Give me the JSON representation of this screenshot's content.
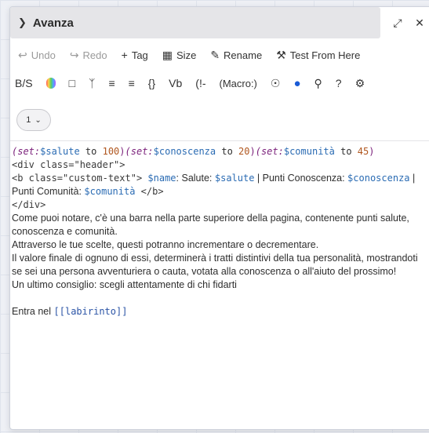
{
  "dialog": {
    "title": "Avanza",
    "collapse_icon": "chevron-down-icon",
    "maximize_icon": "expand-icon",
    "close_icon": "close-icon"
  },
  "toolbar1": {
    "undo": "Undo",
    "redo": "Redo",
    "tag": "Tag",
    "size": "Size",
    "rename": "Rename",
    "test": "Test From Here"
  },
  "toolbar2": {
    "strike": "B/S",
    "brackets": "{}",
    "vb": "Vb",
    "comment": "(!-",
    "macro": "(Macro:)",
    "help": "?"
  },
  "level": {
    "value": "1"
  },
  "code": {
    "set1_kw": "(set:",
    "set1_var": "$salute",
    "set1_to": " to ",
    "set1_num": "100",
    "set1_close": ")",
    "set2_kw": "(set:",
    "set2_var": "$conoscenza",
    "set2_to": " to ",
    "set2_num": "20",
    "set2_close": ")",
    "set3_kw": "(set:",
    "set3_var": "$comunità",
    "set3_to": " to ",
    "set3_num": "45",
    "set3_close": ")",
    "div_open": "<div class=\"header\">",
    "b_open": " <b class=\"custom-text\">",
    "name_var": " $name",
    "salute_label": ": Salute: ",
    "salute_var": "$salute",
    "know_label": " | Punti Conoscenza: ",
    "know_var": "$conoscenza",
    "sep": " |",
    "comm_label": "Punti Comunità: ",
    "comm_var": "$comunità",
    "b_close": " </b>",
    "div_close": "</div>",
    "p1": "Come puoi notare, c'è una barra nella parte superiore della pagina, contenente punti salute, conoscenza e comunità.",
    "p2": "Attraverso le tue scelte, questi potranno incrementare o decrementare.",
    "p3": "Il valore finale di ognuno di essi, determinerà i tratti distintivi della tua personalità, mostrandoti se sei una persona avventuriera o cauta, votata alla conoscenza o all'aiuto del prossimo!",
    "p4": "Un ultimo consiglio: scegli attentamente di chi fidarti",
    "enter_prefix": "Entra nel ",
    "enter_link": "[[labirinto]]"
  }
}
